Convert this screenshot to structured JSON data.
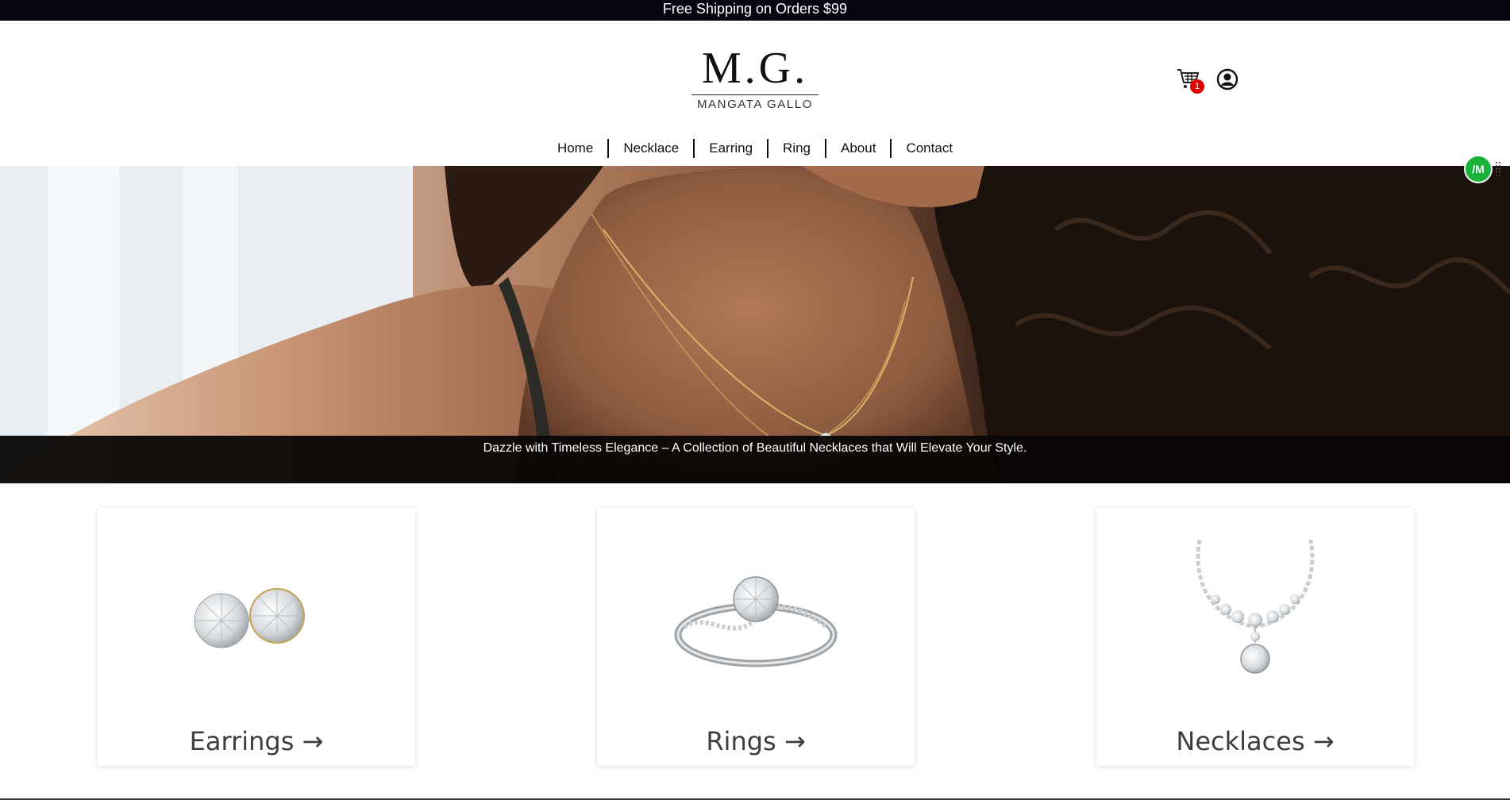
{
  "topbar": {
    "text": "Free Shipping on Orders $99"
  },
  "logo": {
    "mark": "M.G.",
    "subtitle": "MANGATA GALLO"
  },
  "header": {
    "cart": {
      "icon": "cart-icon",
      "count": "1",
      "badge_color": "#e00000"
    },
    "account": {
      "icon": "user-circle-icon"
    }
  },
  "nav": {
    "items": [
      {
        "label": "Home"
      },
      {
        "label": "Necklace"
      },
      {
        "label": "Earring"
      },
      {
        "label": "Ring"
      },
      {
        "label": "About"
      },
      {
        "label": "Contact"
      }
    ]
  },
  "hero": {
    "caption": "Dazzle with Timeless Elegance – A Collection of Beautiful Necklaces that Will Elevate Your Style."
  },
  "widget": {
    "label": "/M",
    "color": "#17b237"
  },
  "categories": [
    {
      "title": "Earrings →",
      "image": "earrings-image"
    },
    {
      "title": "Rings →",
      "image": "ring-image"
    },
    {
      "title": "Necklaces →",
      "image": "necklace-image"
    }
  ],
  "colors": {
    "topbar_bg": "#05050f",
    "caption_bg": "#080605",
    "text_dark": "#3d3d3d"
  }
}
